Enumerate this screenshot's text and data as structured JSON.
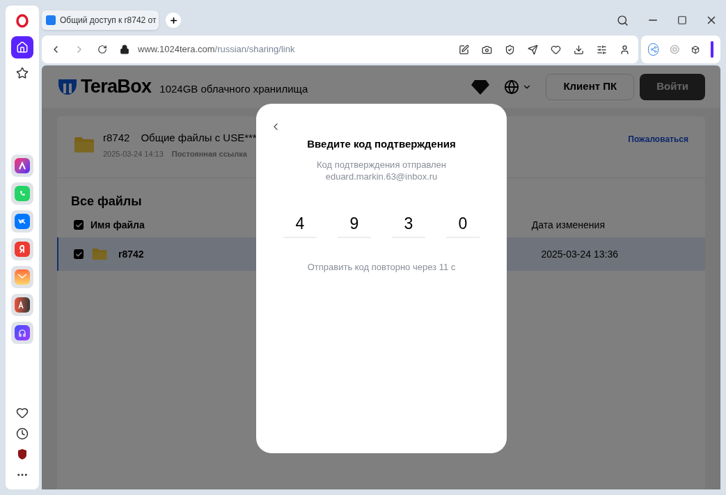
{
  "browser": {
    "tab": {
      "title": "Общий доступ к r8742 от",
      "selected": true
    },
    "address": {
      "domain": "www.1024tera.com",
      "path": "/russian/sharing/link"
    }
  },
  "header": {
    "brand": "TeraBox",
    "tagline": "1024GB облачного хранилища",
    "buttons": [
      {
        "label": "Клиент ПК",
        "kind": "outline"
      },
      {
        "label": "Войти",
        "kind": "primary"
      }
    ]
  },
  "share": {
    "name": "r8742",
    "title": "Общие файлы с USE***",
    "date": "2025-03-24 14:13",
    "link_type": "Постоянная ссылка",
    "report": "Пожаловаться"
  },
  "files": {
    "heading": "Все файлы",
    "all_checked": true,
    "columns": [
      "Имя файла",
      "Дата изменения"
    ],
    "rows": [
      {
        "name": "r8742",
        "date": "2025-03-24 13:36",
        "checked": true,
        "selected": true
      }
    ]
  },
  "dialog": {
    "title": "Введите код подтверждения",
    "message": "Код подтверждения отправлен",
    "email": "eduard.markin.63@inbox.ru",
    "code": [
      "4",
      "9",
      "3",
      "0"
    ],
    "resend": "Отправить код повторно через 11 с"
  }
}
